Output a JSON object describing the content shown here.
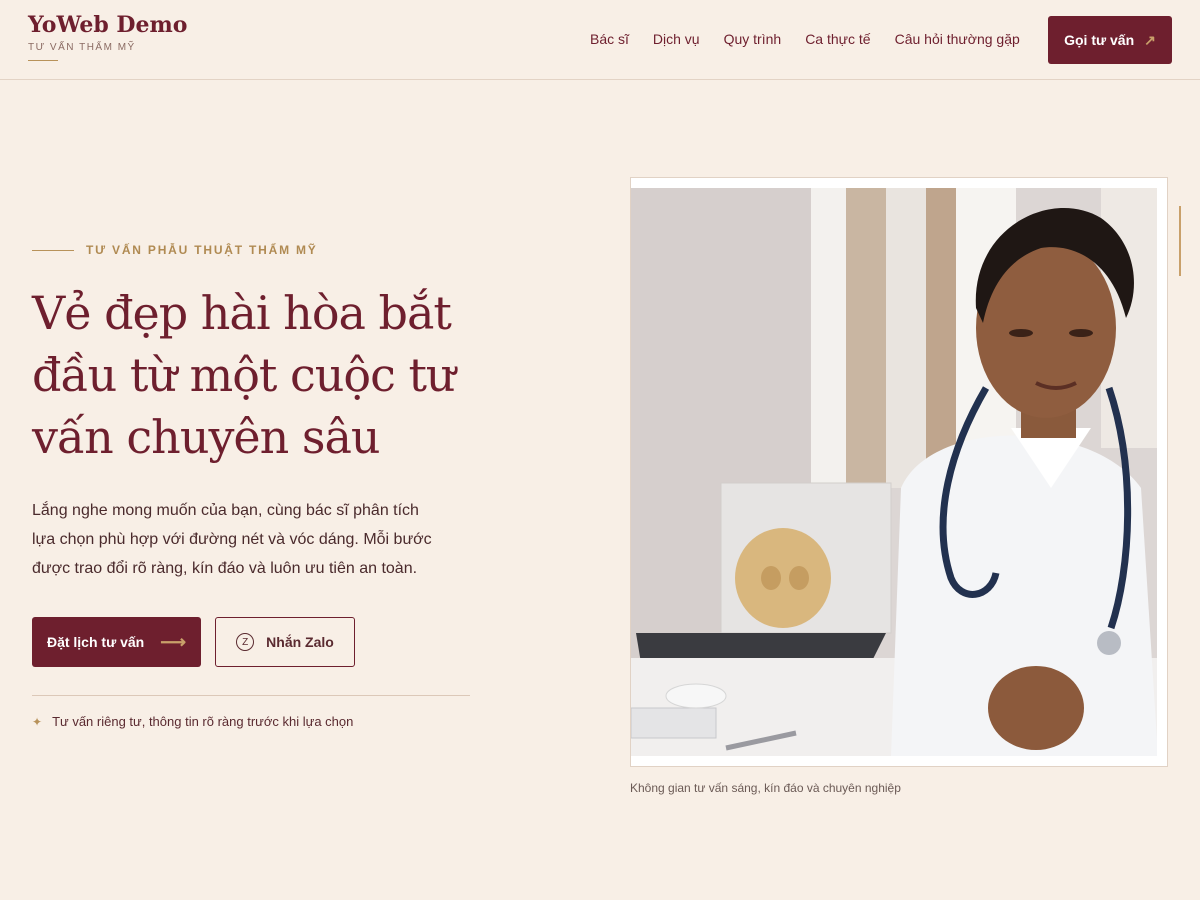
{
  "header": {
    "brand_name": "YoWeb Demo",
    "brand_sub": "TƯ VẤN THẨM MỸ",
    "nav": [
      "Bác sĩ",
      "Dịch vụ",
      "Quy trình",
      "Ca thực tế",
      "Câu hỏi thường gặp"
    ],
    "cta_label": "Gọi tư vấn",
    "cta_icon": "arrow-up-right-icon"
  },
  "hero": {
    "eyebrow": "TƯ VẤN PHẪU THUẬT THẨM MỸ",
    "headline_lines": [
      "Vẻ đẹp hài hòa bắt",
      "đầu từ một cuộc tư",
      "vấn chuyên sâu"
    ],
    "lead_lines": [
      "Lắng nghe mong muốn của bạn, cùng bác sĩ phân tích",
      "lựa chọn phù hợp với đường nét và vóc dáng. Mỗi bước",
      "được trao đổi rõ ràng, kín đáo và luôn ưu tiên an toàn."
    ],
    "primary_button": "Đặt lịch tư vấn",
    "secondary_button": "Nhắn Zalo",
    "zalo_icon_letter": "Z",
    "note": "Tư vấn riêng tư, thông tin rõ ràng trước khi lựa chọn",
    "image_caption": "Không gian tư vấn sáng, kín đáo và chuyên nghiệp"
  },
  "colors": {
    "background": "#f8efe6",
    "primary": "#6e1f2e",
    "accent_gold": "#b8925a"
  }
}
